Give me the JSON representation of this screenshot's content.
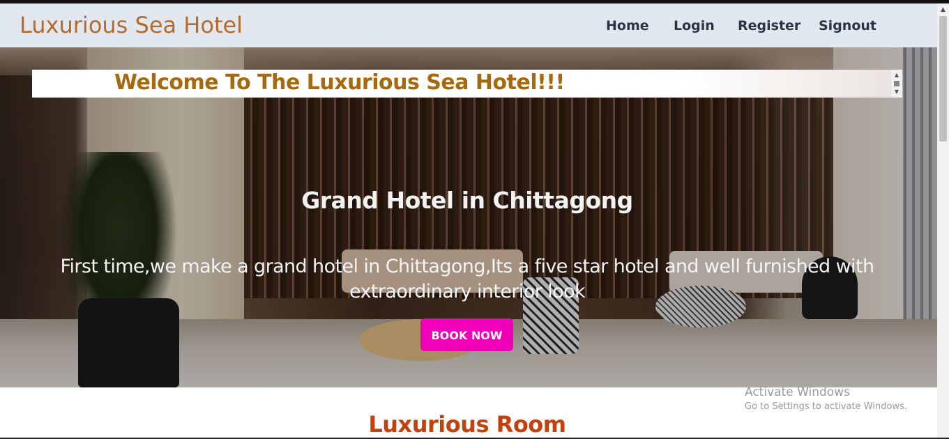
{
  "navbar": {
    "brand": "Luxurious Sea Hotel",
    "links": [
      {
        "label": "Home"
      },
      {
        "label": "Login"
      },
      {
        "label": "Register"
      },
      {
        "label": "Signout"
      }
    ]
  },
  "hero": {
    "marquee_text": "Welcome To The Luxurious Sea Hotel!!!",
    "title": "Grand Hotel in Chittagong",
    "description": "First time,we make a grand hotel in Chittagong,Its a five star hotel and well furnished with extraordinary interior look",
    "button_label": "BOOK NOW"
  },
  "section": {
    "title": "Luxurious Room"
  },
  "watermark": {
    "line1": "Activate Windows",
    "line2": "Go to Settings to activate Windows."
  },
  "colors": {
    "brand": "#b8692c",
    "navbar_bg": "#e2e8f0",
    "nav_link": "#2a3344",
    "marquee_text": "#a5690f",
    "book_button": "#f000b8",
    "section_title": "#c2410c"
  }
}
